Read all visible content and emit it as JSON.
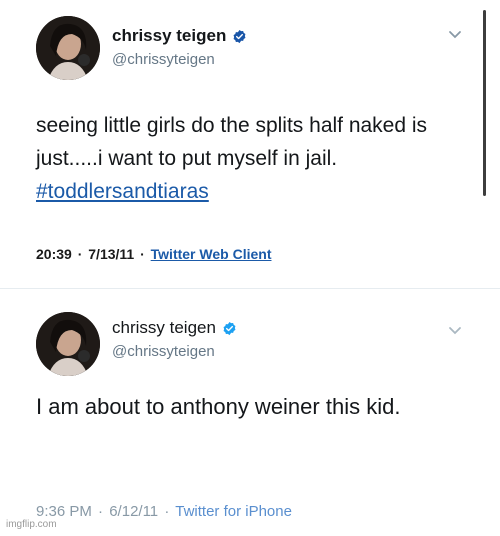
{
  "tweets": [
    {
      "display_name": "chrissy teigen",
      "handle": "@chrissyteigen",
      "text": "seeing little girls do the splits half naked is just.....i want to put myself in jail.",
      "hashtag": "#toddlersandtiaras",
      "time": "20:39",
      "date": "7/13/11",
      "separator": "·",
      "client": "Twitter Web Client"
    },
    {
      "display_name": "chrissy teigen",
      "handle": "@chrissyteigen",
      "text": "I am about to anthony weiner this kid.",
      "hashtag": "",
      "time": "9:36 PM",
      "date": "6/12/11",
      "separator": "·",
      "client": "Twitter for iPhone"
    }
  ],
  "icons": {
    "verified": "verified-badge-icon",
    "caret": "chevron-down-icon",
    "avatar": "profile-avatar"
  },
  "colors": {
    "verified_badge": "#1da1f2",
    "link": "#1b5aa8",
    "secondary_text": "#657786"
  },
  "watermark": "imgflip.com"
}
